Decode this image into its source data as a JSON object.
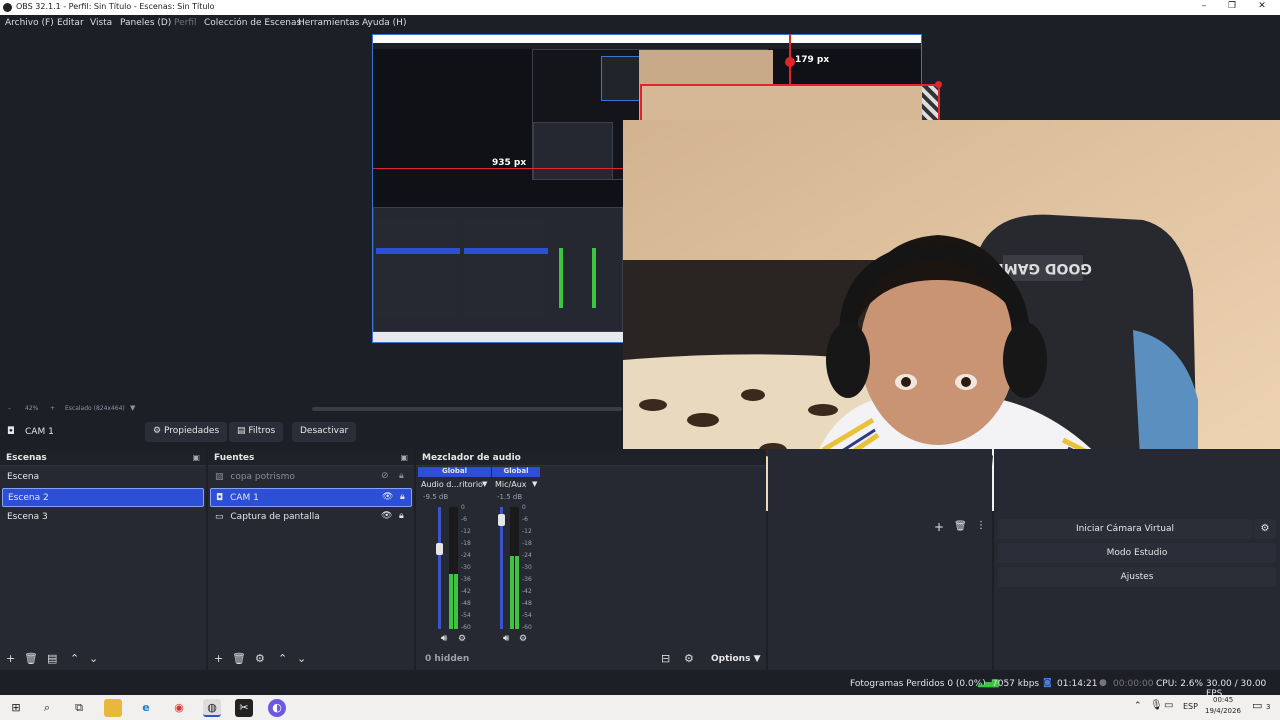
{
  "window": {
    "title": "OBS 32.1.1 - Perfil: Sin Título - Escenas: Sin Título",
    "controls": {
      "minimize": "–",
      "restore": "❐",
      "close": "✕"
    }
  },
  "menu": {
    "items": [
      "Archivo (F)",
      "Editar",
      "Vista",
      "Paneles (D)",
      "Perfil",
      "Colección de Escenas",
      "Herramientas",
      "Ayuda (H)"
    ]
  },
  "preview": {
    "measure_vertical": "179 px",
    "measure_horizontal": "935 px",
    "zoom_minus": "–",
    "zoom_level": "42%",
    "zoom_plus": "+",
    "scale_label": "Escalado (824x464)"
  },
  "source_toolbar": {
    "selected_source": "CAM 1",
    "properties_label": "Propiedades",
    "filters_label": "Filtros",
    "deactivate_label": "Desactivar"
  },
  "scenes": {
    "title": "Escenas",
    "items": [
      "Escena",
      "Escena 2",
      "Escena 3"
    ],
    "selected_index": 1
  },
  "sources": {
    "title": "Fuentes",
    "items": [
      {
        "name": "copa potrismo",
        "visible": false
      },
      {
        "name": "CAM 1",
        "visible": true,
        "selected": true
      },
      {
        "name": "Captura de pantalla",
        "visible": true
      }
    ]
  },
  "mixer": {
    "title": "Mezclador de audio",
    "channels": [
      {
        "global": "Global",
        "name": "Audio d...ritorio",
        "db": "-9.5 dB",
        "level": 0.45
      },
      {
        "global": "Global",
        "name": "Mic/Aux",
        "db": "-1.5 dB",
        "level": 0.6
      }
    ],
    "ticks": [
      "0",
      "-6",
      "-12",
      "-18",
      "-24",
      "-30",
      "-36",
      "-42",
      "-48",
      "-54",
      "-60"
    ],
    "hidden_label": "0 hidden",
    "options_label": "Options"
  },
  "controls": {
    "virtual_cam": "Iniciar Cámara Virtual",
    "studio_mode": "Modo Estudio",
    "settings": "Ajustes"
  },
  "status": {
    "dropped_frames": "Fotogramas Perdidos 0 (0.0%)",
    "bitrate": "7057 kbps",
    "stream_time": "01:14:21",
    "record_time": "00:00:00",
    "cpu": "CPU: 2.6%",
    "fps": "30.00 / 30.00 FPS"
  },
  "taskbar": {
    "language": "ESP",
    "time": "00:45",
    "date": "19/4/2026",
    "notifications": "3"
  },
  "colors": {
    "accent": "#2c4fd6",
    "bg": "#1d1f26",
    "panel": "#262932",
    "measure_red": "#e0262a",
    "canvas_border": "#3a74d6",
    "meter_green": "#3ec43e"
  }
}
